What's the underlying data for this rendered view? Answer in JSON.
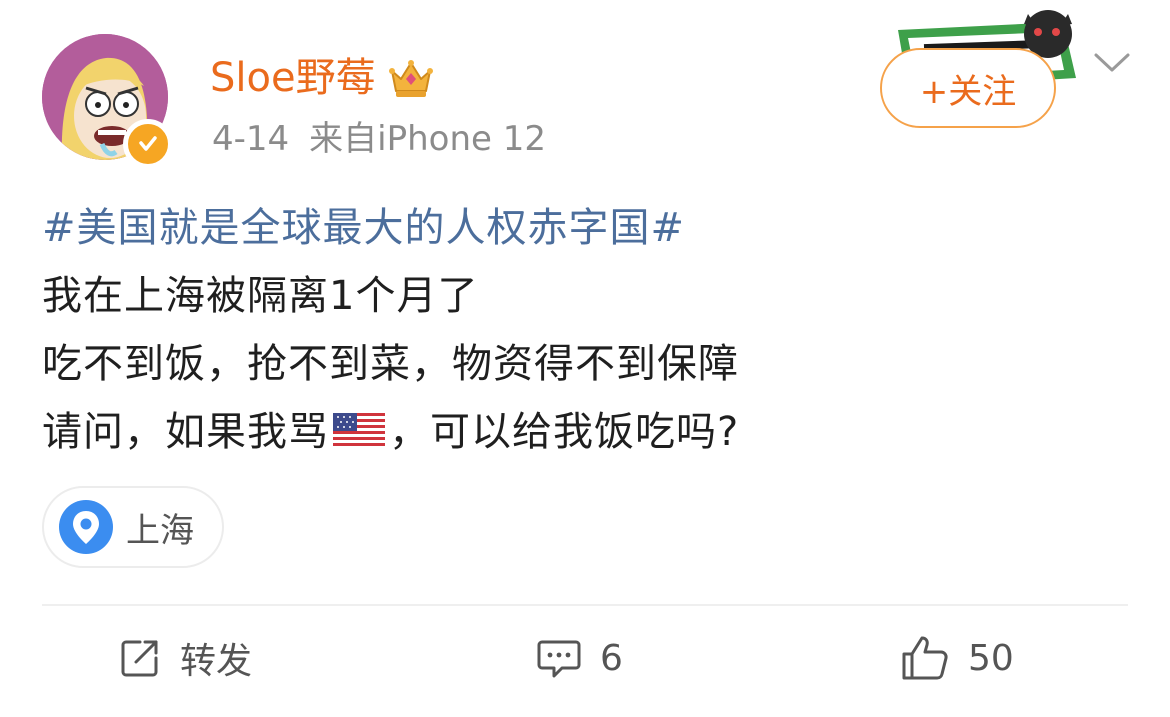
{
  "author": {
    "name": "Sloe野莓",
    "verified": true,
    "badge_color": "#f6a623",
    "name_color": "#ea6b1d",
    "avatar_icon": "cartoon-avatar-icon",
    "crown_icon": "vip-crown-icon"
  },
  "meta": {
    "date": "4-14",
    "source": "来自iPhone 12"
  },
  "header": {
    "follow_label": "+关注",
    "more_icon": "chevron-down-icon"
  },
  "post": {
    "hashtag": "#美国就是全球最大的人权赤字国#",
    "line1": "我在上海被隔离1个月了",
    "line2": "吃不到饭，抢不到菜，物资得不到保障",
    "line3_before_flag": "请问，如果我骂",
    "line3_flag_icon": "us-flag-icon",
    "line3_after_flag": "，可以给我饭吃吗?",
    "hashtag_color": "#4c6e9c"
  },
  "location": {
    "label": "上海",
    "icon": "location-pin-icon",
    "icon_color": "#3b8df0"
  },
  "actions": {
    "repost_label": "转发",
    "comment_count": "6",
    "like_count": "50"
  }
}
